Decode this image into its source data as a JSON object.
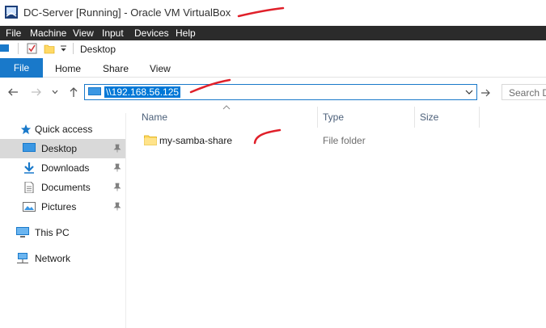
{
  "vbox": {
    "title": "DC-Server [Running] - Oracle VM VirtualBox",
    "menu": [
      "File",
      "Machine",
      "View",
      "Input",
      "Devices",
      "Help"
    ]
  },
  "explorer": {
    "window_title": "Desktop",
    "ribbon": {
      "file_tab": "File",
      "tabs": [
        "Home",
        "Share",
        "View"
      ]
    },
    "address": {
      "value": "\\\\192.168.56.125"
    },
    "search": {
      "placeholder": "Search D"
    },
    "sidebar": {
      "quick_access": "Quick access",
      "items": [
        {
          "label": "Desktop",
          "icon": "desktop-icon",
          "pinned": true,
          "selected": true
        },
        {
          "label": "Downloads",
          "icon": "downloads-icon",
          "pinned": true
        },
        {
          "label": "Documents",
          "icon": "documents-icon",
          "pinned": true
        },
        {
          "label": "Pictures",
          "icon": "pictures-icon",
          "pinned": true
        }
      ],
      "this_pc": "This PC",
      "network": "Network"
    },
    "columns": {
      "name": "Name",
      "type": "Type",
      "size": "Size"
    },
    "files": [
      {
        "name": "my-samba-share",
        "type": "File folder",
        "icon": "folder-icon"
      }
    ],
    "colors": {
      "accent": "#1979ca",
      "selection": "#0078d7",
      "annotation": "#e0202a"
    }
  }
}
